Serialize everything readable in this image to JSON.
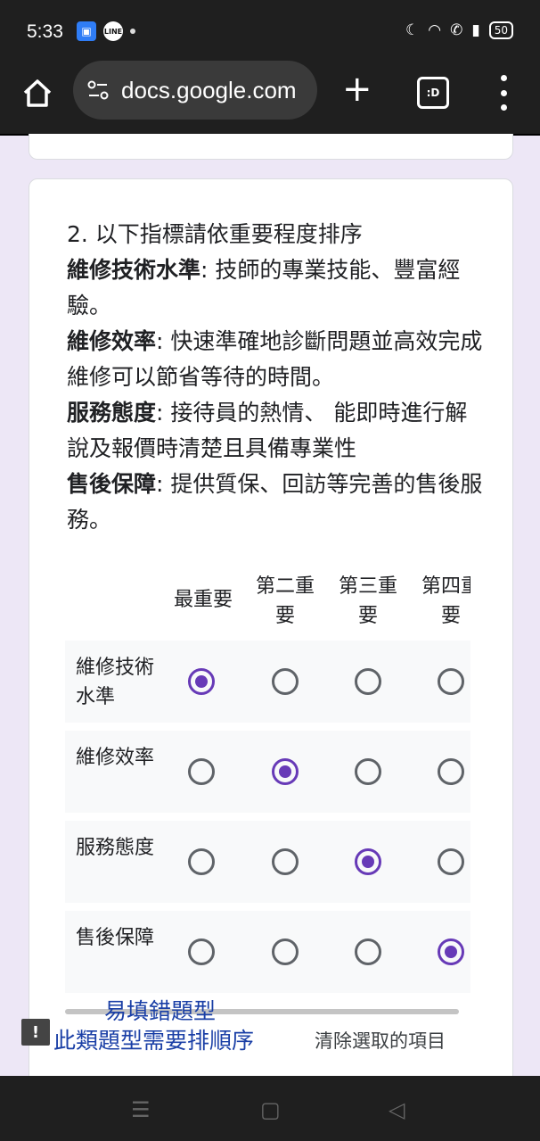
{
  "status_bar": {
    "time": "5:33",
    "battery": "50",
    "line_label": "LINE"
  },
  "browser": {
    "url": "docs.google.com",
    "tabs_label": ":D"
  },
  "question": {
    "title": "2. 以下指標請依重要程度排序",
    "items": [
      {
        "term": "維修技術水準",
        "desc": ": 技師的專業技能、豐富經驗。"
      },
      {
        "term": "維修效率",
        "desc": ": 快速準確地診斷問題並高效完成維修可以節省等待的時間。"
      },
      {
        "term": "服務態度",
        "desc": ": 接待員的熱情、 能即時進行解說及報價時清楚且具備專業性"
      },
      {
        "term": "售後保障",
        "desc": ": 提供質保、回訪等完善的售後服務。"
      }
    ]
  },
  "grid": {
    "columns": [
      "最重要",
      "第二重要",
      "第三重要",
      "第四重要"
    ],
    "rows": [
      {
        "label": "維修技術水準",
        "selected": 0
      },
      {
        "label": "維修效率",
        "selected": 1
      },
      {
        "label": "服務態度",
        "selected": 2
      },
      {
        "label": "售後保障",
        "selected": 3
      }
    ],
    "clear_label": "清除選取的項目"
  },
  "annotation": {
    "line1": "易填錯題型",
    "line2": "此類題型需要排順序",
    "icon": "!"
  },
  "accent_color": "#673ab7"
}
